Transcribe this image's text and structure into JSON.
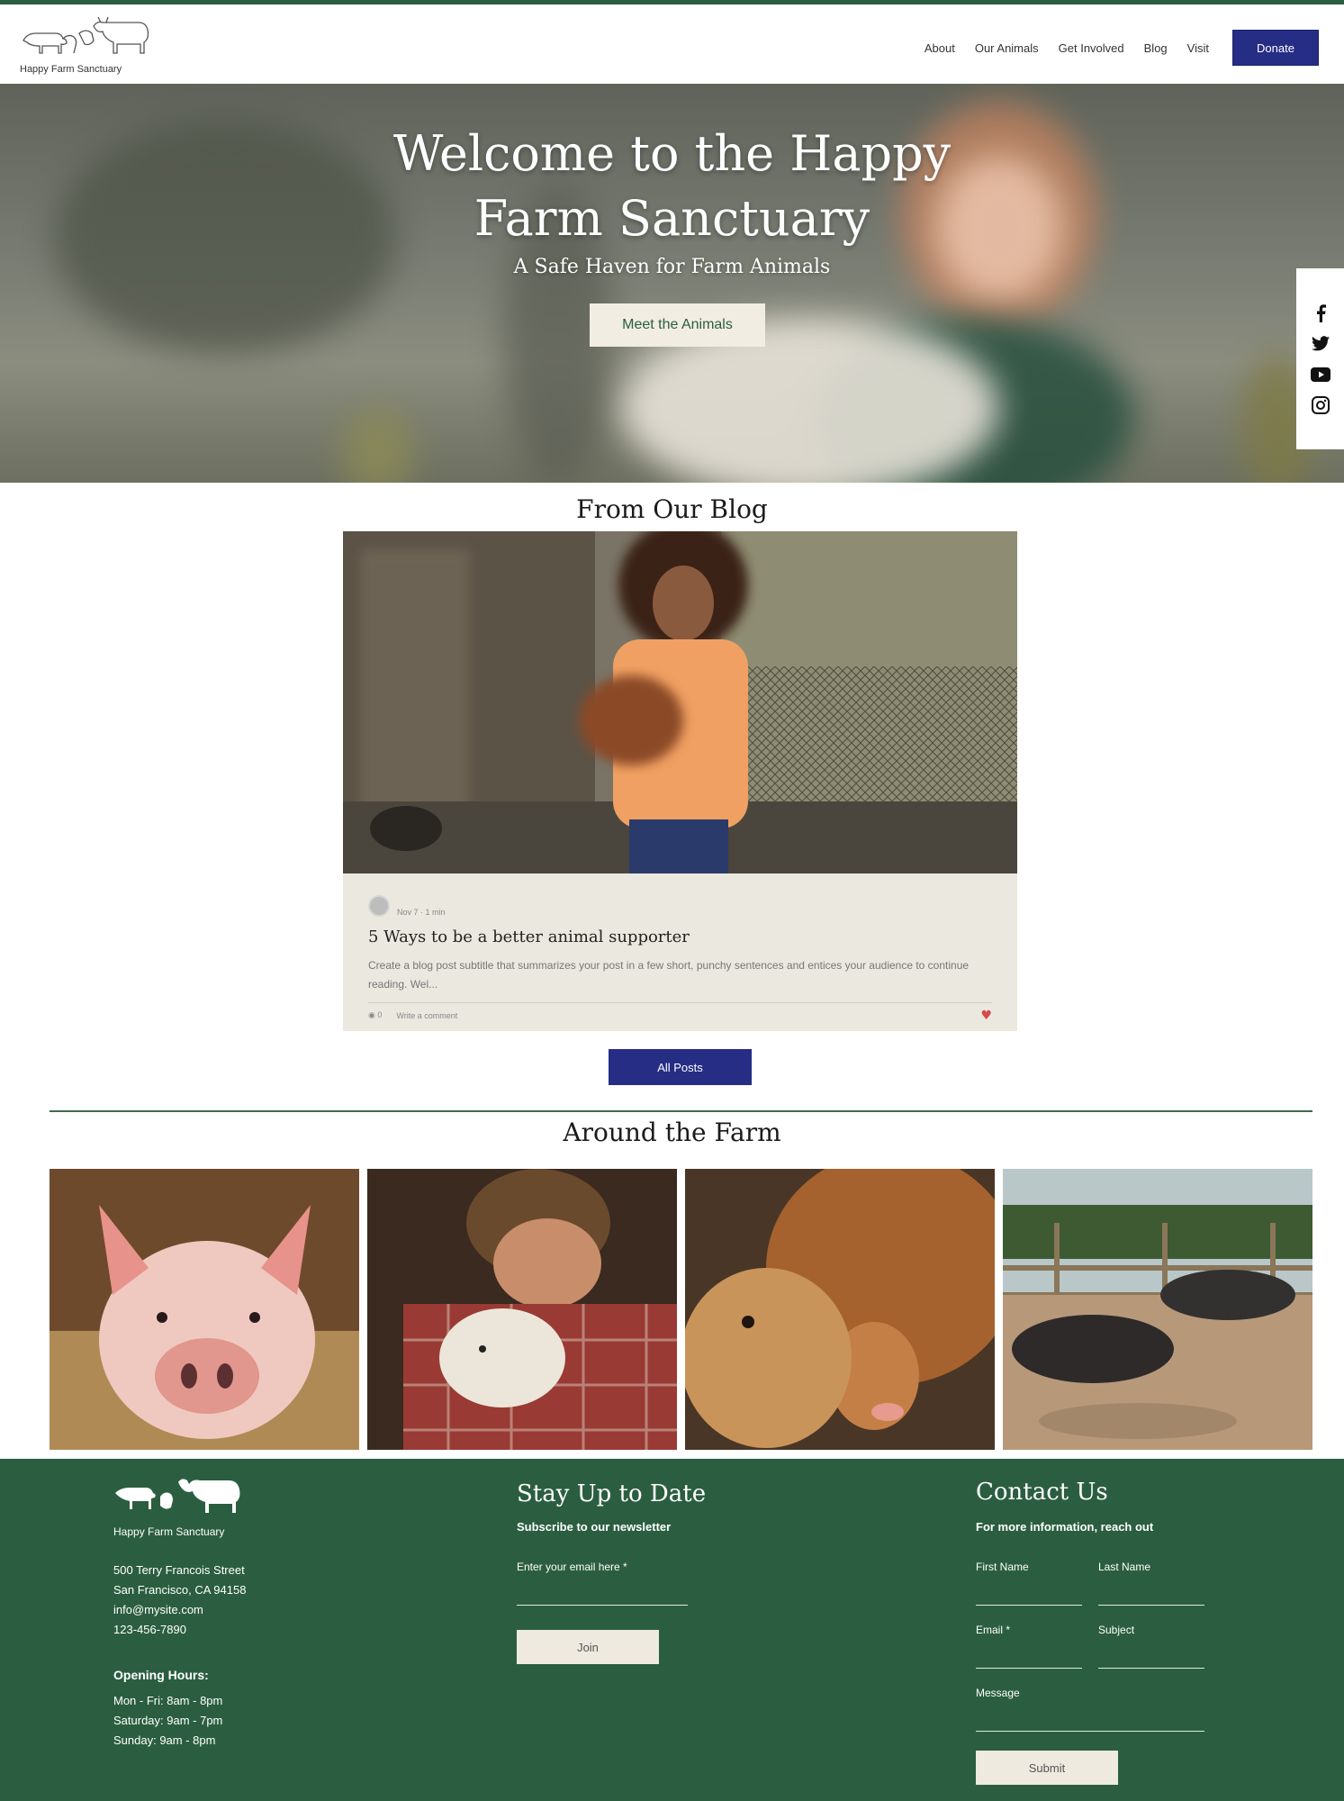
{
  "header": {
    "logo_text": "Happy Farm Sanctuary",
    "nav": [
      "About",
      "Our Animals",
      "Get Involved",
      "Blog",
      "Visit"
    ],
    "donate_label": "Donate"
  },
  "hero": {
    "title_line1": "Welcome to the Happy",
    "title_line2": "Farm Sanctuary",
    "subtitle": "A Safe Haven for Farm Animals",
    "cta_label": "Meet the Animals"
  },
  "social": [
    "facebook-icon",
    "twitter-icon",
    "youtube-icon",
    "instagram-icon"
  ],
  "blog": {
    "section_title": "From Our Blog",
    "post": {
      "meta": "Nov 7 · 1 min",
      "title": "5 Ways to be a better animal supporter",
      "excerpt": "Create a blog post subtitle that summarizes your post in a few short, punchy sentences and entices your audience to continue reading. Wel...",
      "views": "0",
      "comment_label": "Write a comment"
    },
    "all_posts_label": "All Posts"
  },
  "farm": {
    "section_title": "Around the Farm"
  },
  "footer": {
    "logo_text": "Happy Farm Sanctuary",
    "address": [
      "500 Terry Francois Street",
      "San Francisco, CA 94158",
      "info@mysite.com",
      "123-456-7890"
    ],
    "hours_title": "Opening Hours:",
    "hours": [
      "Mon - Fri: 8am - 8pm",
      "Saturday: 9am - 7pm",
      "Sunday: 9am - 8pm"
    ],
    "newsletter": {
      "title": "Stay Up to Date",
      "subtitle": "Subscribe to our newsletter",
      "email_label": "Enter your email here *",
      "join_label": "Join"
    },
    "contact": {
      "title": "Contact Us",
      "subtitle": "For more information, reach out",
      "first_name": "First Name",
      "last_name": "Last Name",
      "email": "Email *",
      "subject": "Subject",
      "message": "Message",
      "submit_label": "Submit"
    }
  },
  "colors": {
    "brand_green": "#2b5e40",
    "button_blue": "#262d85",
    "cream": "#f1ede2"
  }
}
